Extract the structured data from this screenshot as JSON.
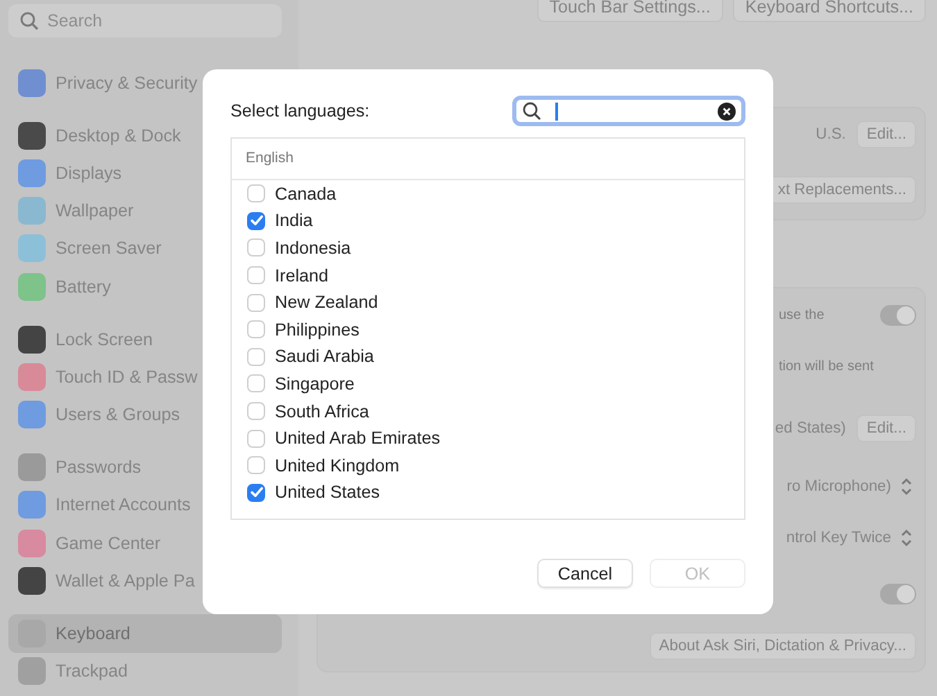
{
  "sidebar": {
    "search": {
      "placeholder": "Search"
    },
    "groups": [
      {
        "items": [
          {
            "label": "Privacy & Security",
            "selected": false,
            "color": "#6f8fd0"
          }
        ]
      },
      {
        "items": [
          {
            "label": "Desktop & Dock",
            "selected": false,
            "color": "#4a4a4a"
          },
          {
            "label": "Displays",
            "selected": false,
            "color": "#6f9be0"
          },
          {
            "label": "Wallpaper",
            "selected": false,
            "color": "#8ab8d0"
          },
          {
            "label": "Screen Saver",
            "selected": false,
            "color": "#8cc0d8"
          },
          {
            "label": "Battery",
            "selected": false,
            "color": "#7dc38a"
          }
        ]
      },
      {
        "items": [
          {
            "label": "Lock Screen",
            "selected": false,
            "color": "#444444"
          },
          {
            "label": "Touch ID & Passw",
            "selected": false,
            "color": "#d88a98"
          },
          {
            "label": "Users & Groups",
            "selected": false,
            "color": "#6f9be0"
          }
        ]
      },
      {
        "items": [
          {
            "label": "Passwords",
            "selected": false,
            "color": "#9a9a9a"
          },
          {
            "label": "Internet Accounts",
            "selected": false,
            "color": "#6f9be0"
          },
          {
            "label": "Game Center",
            "selected": false,
            "color": "#d88aa0"
          },
          {
            "label": "Wallet & Apple Pa",
            "selected": false,
            "color": "#444444"
          }
        ]
      },
      {
        "items": [
          {
            "label": "Keyboard",
            "selected": true,
            "color": "#a8a8a8"
          },
          {
            "label": "Trackpad",
            "selected": false,
            "color": "#a0a0a0"
          }
        ]
      }
    ]
  },
  "main": {
    "top_buttons": [
      "Touch Bar Settings...",
      "Keyboard Shortcuts..."
    ],
    "panels": [
      {
        "rows": [
          {
            "kind": "value_button",
            "value": "U.S.",
            "button": "Edit..."
          },
          {
            "kind": "button",
            "button": "xt Replacements..."
          }
        ]
      },
      {
        "rows": [
          {
            "kind": "text_toggle",
            "text": "use the",
            "on": true
          },
          {
            "kind": "text",
            "text": "tion will be sent"
          },
          {
            "kind": "value_button",
            "value": "ed States)",
            "button": "Edit..."
          },
          {
            "kind": "popup",
            "value": "ro Microphone)"
          },
          {
            "kind": "popup",
            "value": "ntrol Key Twice"
          },
          {
            "kind": "toggle",
            "on": true
          },
          {
            "kind": "button",
            "button": "About Ask Siri, Dictation & Privacy..."
          }
        ]
      }
    ]
  },
  "dialog": {
    "title": "Select languages:",
    "list_header": "English",
    "items": [
      {
        "label": "Canada",
        "checked": false
      },
      {
        "label": "India",
        "checked": true
      },
      {
        "label": "Indonesia",
        "checked": false
      },
      {
        "label": "Ireland",
        "checked": false
      },
      {
        "label": "New Zealand",
        "checked": false
      },
      {
        "label": "Philippines",
        "checked": false
      },
      {
        "label": "Saudi Arabia",
        "checked": false
      },
      {
        "label": "Singapore",
        "checked": false
      },
      {
        "label": "South Africa",
        "checked": false
      },
      {
        "label": "United Arab Emirates",
        "checked": false
      },
      {
        "label": "United Kingdom",
        "checked": false
      },
      {
        "label": "United States",
        "checked": true
      }
    ],
    "buttons": [
      {
        "label": "Cancel",
        "disabled": false
      },
      {
        "label": "OK",
        "disabled": true
      }
    ]
  }
}
